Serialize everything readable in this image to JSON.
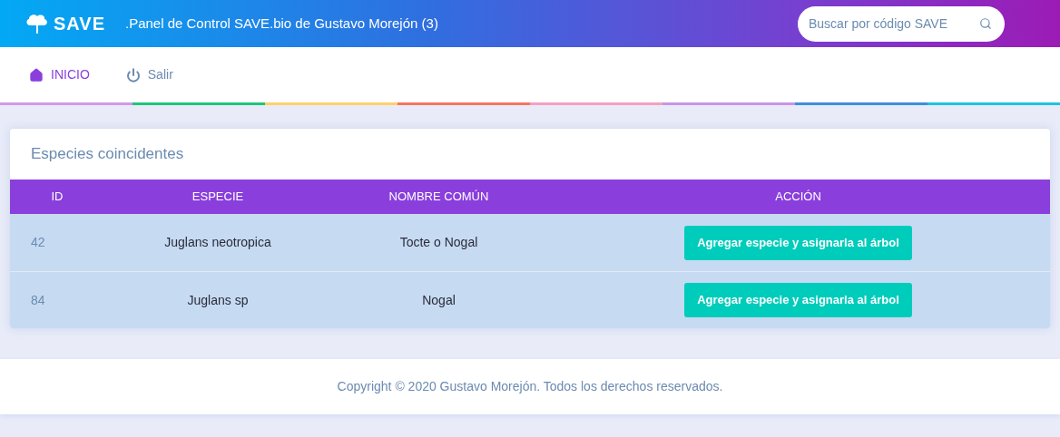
{
  "header": {
    "logo": "SAVE",
    "title": ".Panel de Control SAVE.bio de Gustavo Morejón (3)",
    "search": {
      "placeholder": "Buscar por código SAVE"
    }
  },
  "nav": [
    {
      "label": "INICIO",
      "kind": "home",
      "selected": true
    },
    {
      "label": "Salir",
      "kind": "power",
      "selected": false
    }
  ],
  "card": {
    "title": "Especies coincidentes",
    "table": {
      "columns": [
        "ID",
        "ESPECIE",
        "NOMBRE COMÚN",
        "ACCIÓN"
      ],
      "rows": [
        {
          "id": "42",
          "especie": "Juglans neotropica",
          "nombre": "Tocte o Nogal",
          "action": "Agregar especie y asignarla al árbol"
        },
        {
          "id": "84",
          "especie": "Juglans sp",
          "nombre": "Nogal",
          "action": "Agregar especie y asignarla al árbol"
        }
      ]
    }
  },
  "footer": "Copyright © 2020 Gustavo Morejón. Todos los derechos reservados."
}
